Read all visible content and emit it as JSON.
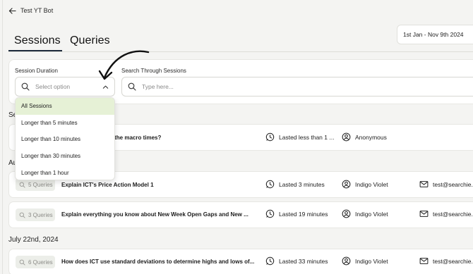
{
  "app": {
    "back_label": "Test YT Bot"
  },
  "tabs": [
    {
      "label": "Sessions"
    },
    {
      "label": "Queries"
    }
  ],
  "date_range": {
    "value": "1st Jan - Nov 9th 2024"
  },
  "filters": {
    "duration_label": "Session Duration",
    "duration_placeholder": "Select option",
    "search_label": "Search Through Sessions",
    "search_placeholder": "Type here...",
    "duration_options": [
      "All Sessions",
      "Longer than 5 minutes",
      "Longer than 10 minutes",
      "Longer than 30 minutes",
      "Longer than 1 hour"
    ],
    "selected_option": "All Sessions"
  },
  "groups": [
    {
      "date": "Se"
    },
    {
      "date": "Au"
    },
    {
      "date": "July 22nd, 2024"
    }
  ],
  "sessions": [
    {
      "queries": "",
      "title": "ic times for each of the macro times?",
      "duration": "Lasted less than 1 ...",
      "user": "Anonymous",
      "email": ""
    },
    {
      "queries": "5 Queries",
      "title": "Explain ICT's Price Action Model 1",
      "duration": "Lasted 3 minutes",
      "user": "Indigo Violet",
      "email": "test@searchie.i"
    },
    {
      "queries": "3 Queries",
      "title": "Explain everything you know about New Week Open Gaps and New ...",
      "duration": "Lasted 19 minutes",
      "user": "Indigo Violet",
      "email": "test@searchie.i"
    },
    {
      "queries": "6 Queries",
      "title": "How does ICT use standard deviations to determine highs and lows of...",
      "duration": "Lasted 33 minutes",
      "user": "Indigo Violet",
      "email": "test@searchie.i"
    }
  ],
  "colors": {
    "selected_option_bg": "#e6f1d6",
    "tab_underline": "#1d2a3a",
    "page_bg": "#f4f4f2"
  }
}
